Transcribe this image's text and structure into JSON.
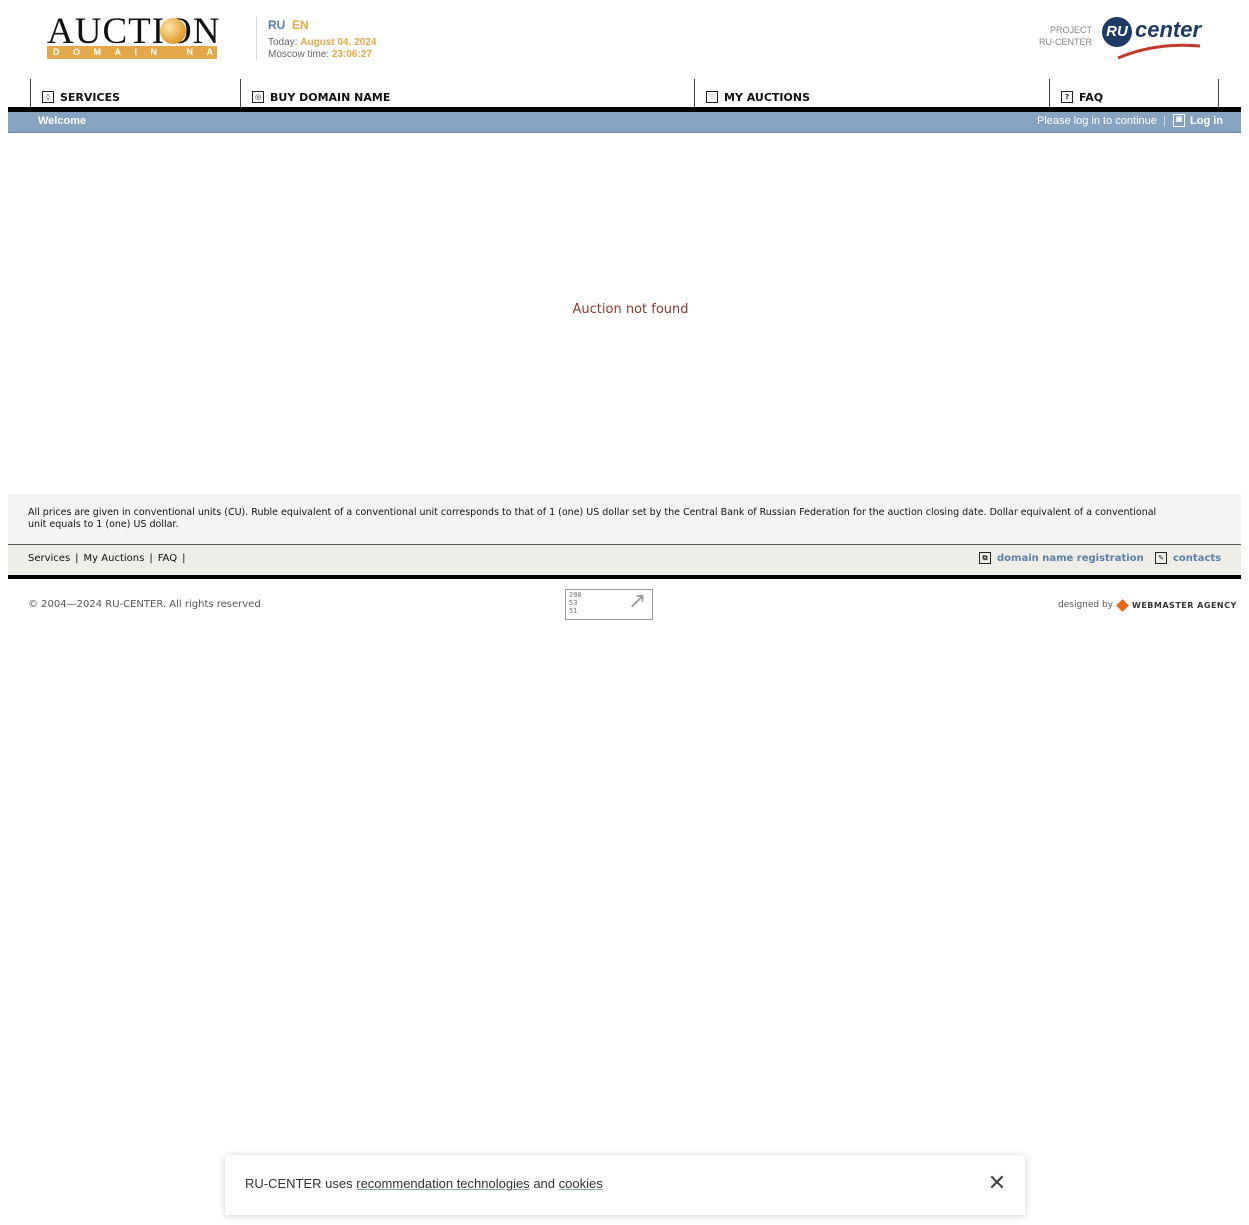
{
  "header": {
    "logo_word": "AUCTION",
    "logo_tagline": "DOMAIN NAME",
    "lang_ru": "RU",
    "lang_en": "EN",
    "today_label": "Today:",
    "today_value": "August 04, 2024",
    "time_label": "Moscow time:",
    "time_value": "23:06:27",
    "project_line1": "PROJECT",
    "project_line2": "RU-CENTER",
    "brand_badge": "RU",
    "brand_word": "center"
  },
  "nav": {
    "items": [
      {
        "label": "SERVICES",
        "icon": "services-icon"
      },
      {
        "label": "BUY DOMAIN NAME",
        "icon": "buy-icon"
      },
      {
        "label": "MY AUCTIONS",
        "icon": "auctions-icon"
      },
      {
        "label": "FAQ",
        "icon": "faq-icon"
      }
    ]
  },
  "subbar": {
    "welcome": "Welcome",
    "please": "Please log in to continue",
    "pipe": "|",
    "login": "Log in"
  },
  "main": {
    "message": "Auction not found"
  },
  "footer": {
    "note": "All prices are given in conventional units (CU). Ruble equivalent of a conventional unit corresponds to that of 1 (one) US dollar set by the Central Bank of Russian Federation for the auction closing date. Dollar equivalent of a conventional unit equals to 1 (one) US dollar.",
    "links": [
      "Services",
      "My Auctions",
      "FAQ"
    ],
    "sep": "|",
    "domain_registration": "domain name registration",
    "contacts": "contacts",
    "copyright": "© 2004—2024 RU-CENTER. All rights reserved",
    "counter_lines": [
      "200",
      "53",
      "51"
    ],
    "designed_by": "designed by",
    "agency": "WEBMASTER AGENCY"
  },
  "cookie": {
    "prefix": "RU-CENTER uses",
    "link1": "recommendation technologies",
    "and": "and",
    "link2": "cookies",
    "close_icon": "close-icon"
  }
}
